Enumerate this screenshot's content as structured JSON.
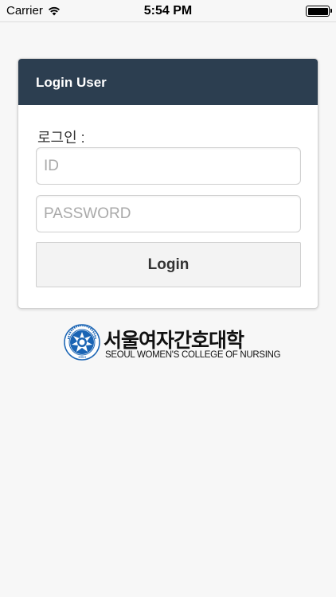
{
  "status_bar": {
    "carrier": "Carrier",
    "time": "5:54 PM",
    "wifi_icon": "wifi-icon",
    "battery_icon": "battery-icon"
  },
  "panel": {
    "title": "Login User",
    "login_label": "로그인 :",
    "id_placeholder": "ID",
    "id_value": "",
    "password_placeholder": "PASSWORD",
    "password_value": "",
    "login_button": "Login"
  },
  "logo": {
    "name_kr": "서울여자간호대학",
    "name_en": "SEOUL WOMEN'S COLLEGE OF NURSING",
    "emblem_year": "1964"
  },
  "colors": {
    "header_bg": "#2c3e50",
    "emblem_blue": "#1a64b4",
    "background": "#f7f7f7"
  }
}
